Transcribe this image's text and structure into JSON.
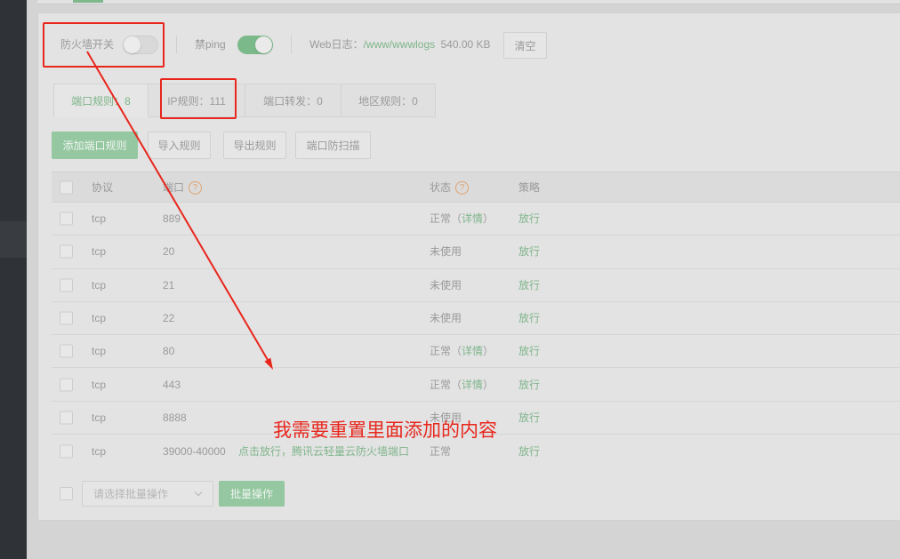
{
  "firewall": {
    "switch_label": "防火墙开关",
    "switch_on": false,
    "ping_label": "禁ping",
    "ping_on": true,
    "weblog_label": "Web日志：",
    "weblog_path": "/www/wwwlogs",
    "weblog_size": "540.00 KB",
    "clear_label": "清空"
  },
  "tabs": [
    {
      "label": "端口规则：8",
      "active": true
    },
    {
      "label": "IP规则：111",
      "active": false
    },
    {
      "label": "端口转发：0",
      "active": false
    },
    {
      "label": "地区规则：0",
      "active": false
    }
  ],
  "toolbar": {
    "add_label": "添加端口规则",
    "import_label": "导入规则",
    "export_label": "导出规则",
    "scan_label": "端口防扫描"
  },
  "table": {
    "headers": {
      "protocol": "协议",
      "port": "端口",
      "status": "状态",
      "policy": "策略"
    },
    "help_glyph": "?",
    "paren_open": "（",
    "paren_close": "）",
    "rows": [
      {
        "protocol": "tcp",
        "port": "889",
        "status": "正常",
        "detail": "详情",
        "policy": "放行"
      },
      {
        "protocol": "tcp",
        "port": "20",
        "status": "未使用",
        "policy": "放行"
      },
      {
        "protocol": "tcp",
        "port": "21",
        "status": "未使用",
        "policy": "放行"
      },
      {
        "protocol": "tcp",
        "port": "22",
        "status": "未使用",
        "policy": "放行"
      },
      {
        "protocol": "tcp",
        "port": "80",
        "status": "正常",
        "detail": "详情",
        "policy": "放行"
      },
      {
        "protocol": "tcp",
        "port": "443",
        "status": "正常",
        "detail": "详情",
        "policy": "放行"
      },
      {
        "protocol": "tcp",
        "port": "8888",
        "status": "未使用",
        "policy": "放行"
      },
      {
        "protocol": "tcp",
        "port": "39000-40000",
        "remark": "点击放行，腾讯云轻量云防火墙端口",
        "status": "正常",
        "policy": "放行"
      }
    ]
  },
  "batch": {
    "select_placeholder": "请选择批量操作",
    "button_label": "批量操作"
  },
  "annotation": {
    "text": "我需要重置里面添加的内容"
  },
  "icons": {
    "help": "help-icon",
    "select_arrow": "chevron-down-icon",
    "annotation_arrow": "arrow-icon"
  },
  "colors": {
    "accent": "#20a53a",
    "annotation": "#e8261c",
    "help_icon": "#f0ad4e"
  }
}
